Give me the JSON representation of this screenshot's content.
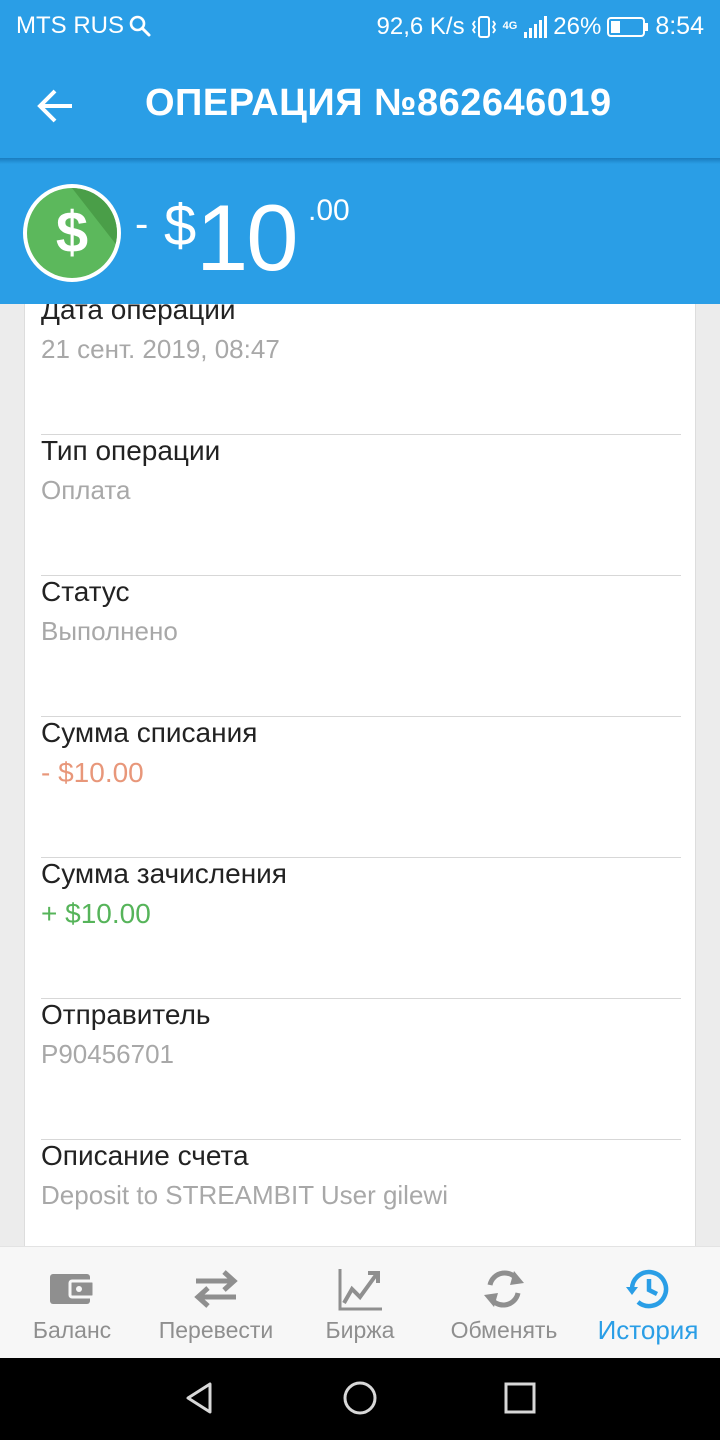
{
  "status_bar": {
    "carrier": "MTS RUS",
    "network_speed": "92,6 K/s",
    "network_type": "4G",
    "battery": "26%",
    "time": "8:54",
    "icons": [
      "search-icon",
      "vibrate-icon",
      "signal-icon",
      "battery-icon"
    ]
  },
  "header": {
    "title": "ОПЕРАЦИЯ №862646019",
    "back_icon": "arrow-back-icon",
    "color": "#2a9ee6"
  },
  "amount": {
    "icon": "dollar-coin-icon",
    "sign": "-",
    "currency": "$",
    "whole": "10",
    "cents": ".00"
  },
  "details": [
    {
      "label": "Дата операции",
      "value": "21 сент. 2019, 08:47",
      "kind": "plain"
    },
    {
      "label": "Тип операции",
      "value": "Оплата",
      "kind": "plain"
    },
    {
      "label": "Статус",
      "value": "Выполнено",
      "kind": "plain"
    },
    {
      "label": "Сумма списания",
      "value": "- $10.00",
      "kind": "debit"
    },
    {
      "label": "Сумма зачисления",
      "value": "+ $10.00",
      "kind": "credit"
    },
    {
      "label": "Отправитель",
      "value": "P90456701",
      "kind": "plain"
    },
    {
      "label": "Описание счета",
      "value": "Deposit to STREAMBIT User gilewi",
      "kind": "plain"
    }
  ],
  "colors": {
    "accent": "#2a9ee6",
    "debit": "#e8977a",
    "credit": "#56b45a",
    "coin": "#5cb85c"
  },
  "bottom_nav": [
    {
      "label": "Баланс",
      "icon": "wallet-icon",
      "active": false
    },
    {
      "label": "Перевести",
      "icon": "transfer-arrows-icon",
      "active": false
    },
    {
      "label": "Биржа",
      "icon": "chart-trend-icon",
      "active": false
    },
    {
      "label": "Обменять",
      "icon": "exchange-refresh-icon",
      "active": false
    },
    {
      "label": "История",
      "icon": "history-clock-icon",
      "active": true
    }
  ],
  "system_nav": [
    "back-triangle-icon",
    "home-circle-icon",
    "recents-square-icon"
  ]
}
